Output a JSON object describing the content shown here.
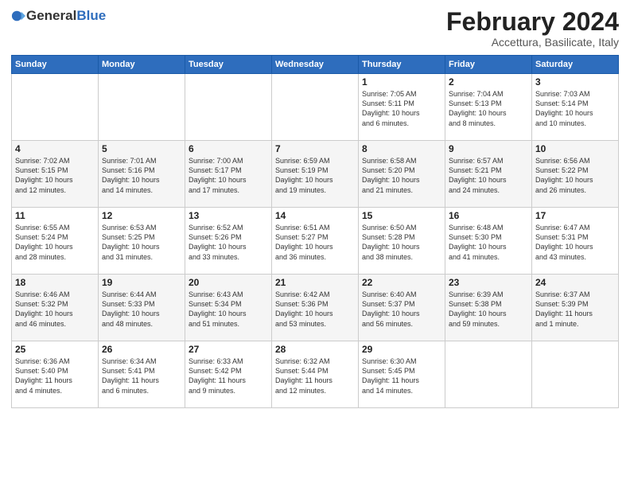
{
  "header": {
    "logo_general": "General",
    "logo_blue": "Blue",
    "month": "February 2024",
    "location": "Accettura, Basilicate, Italy"
  },
  "days_of_week": [
    "Sunday",
    "Monday",
    "Tuesday",
    "Wednesday",
    "Thursday",
    "Friday",
    "Saturday"
  ],
  "weeks": [
    [
      {
        "day": "",
        "content": ""
      },
      {
        "day": "",
        "content": ""
      },
      {
        "day": "",
        "content": ""
      },
      {
        "day": "",
        "content": ""
      },
      {
        "day": "1",
        "content": "Sunrise: 7:05 AM\nSunset: 5:11 PM\nDaylight: 10 hours\nand 6 minutes."
      },
      {
        "day": "2",
        "content": "Sunrise: 7:04 AM\nSunset: 5:13 PM\nDaylight: 10 hours\nand 8 minutes."
      },
      {
        "day": "3",
        "content": "Sunrise: 7:03 AM\nSunset: 5:14 PM\nDaylight: 10 hours\nand 10 minutes."
      }
    ],
    [
      {
        "day": "4",
        "content": "Sunrise: 7:02 AM\nSunset: 5:15 PM\nDaylight: 10 hours\nand 12 minutes."
      },
      {
        "day": "5",
        "content": "Sunrise: 7:01 AM\nSunset: 5:16 PM\nDaylight: 10 hours\nand 14 minutes."
      },
      {
        "day": "6",
        "content": "Sunrise: 7:00 AM\nSunset: 5:17 PM\nDaylight: 10 hours\nand 17 minutes."
      },
      {
        "day": "7",
        "content": "Sunrise: 6:59 AM\nSunset: 5:19 PM\nDaylight: 10 hours\nand 19 minutes."
      },
      {
        "day": "8",
        "content": "Sunrise: 6:58 AM\nSunset: 5:20 PM\nDaylight: 10 hours\nand 21 minutes."
      },
      {
        "day": "9",
        "content": "Sunrise: 6:57 AM\nSunset: 5:21 PM\nDaylight: 10 hours\nand 24 minutes."
      },
      {
        "day": "10",
        "content": "Sunrise: 6:56 AM\nSunset: 5:22 PM\nDaylight: 10 hours\nand 26 minutes."
      }
    ],
    [
      {
        "day": "11",
        "content": "Sunrise: 6:55 AM\nSunset: 5:24 PM\nDaylight: 10 hours\nand 28 minutes."
      },
      {
        "day": "12",
        "content": "Sunrise: 6:53 AM\nSunset: 5:25 PM\nDaylight: 10 hours\nand 31 minutes."
      },
      {
        "day": "13",
        "content": "Sunrise: 6:52 AM\nSunset: 5:26 PM\nDaylight: 10 hours\nand 33 minutes."
      },
      {
        "day": "14",
        "content": "Sunrise: 6:51 AM\nSunset: 5:27 PM\nDaylight: 10 hours\nand 36 minutes."
      },
      {
        "day": "15",
        "content": "Sunrise: 6:50 AM\nSunset: 5:28 PM\nDaylight: 10 hours\nand 38 minutes."
      },
      {
        "day": "16",
        "content": "Sunrise: 6:48 AM\nSunset: 5:30 PM\nDaylight: 10 hours\nand 41 minutes."
      },
      {
        "day": "17",
        "content": "Sunrise: 6:47 AM\nSunset: 5:31 PM\nDaylight: 10 hours\nand 43 minutes."
      }
    ],
    [
      {
        "day": "18",
        "content": "Sunrise: 6:46 AM\nSunset: 5:32 PM\nDaylight: 10 hours\nand 46 minutes."
      },
      {
        "day": "19",
        "content": "Sunrise: 6:44 AM\nSunset: 5:33 PM\nDaylight: 10 hours\nand 48 minutes."
      },
      {
        "day": "20",
        "content": "Sunrise: 6:43 AM\nSunset: 5:34 PM\nDaylight: 10 hours\nand 51 minutes."
      },
      {
        "day": "21",
        "content": "Sunrise: 6:42 AM\nSunset: 5:36 PM\nDaylight: 10 hours\nand 53 minutes."
      },
      {
        "day": "22",
        "content": "Sunrise: 6:40 AM\nSunset: 5:37 PM\nDaylight: 10 hours\nand 56 minutes."
      },
      {
        "day": "23",
        "content": "Sunrise: 6:39 AM\nSunset: 5:38 PM\nDaylight: 10 hours\nand 59 minutes."
      },
      {
        "day": "24",
        "content": "Sunrise: 6:37 AM\nSunset: 5:39 PM\nDaylight: 11 hours\nand 1 minute."
      }
    ],
    [
      {
        "day": "25",
        "content": "Sunrise: 6:36 AM\nSunset: 5:40 PM\nDaylight: 11 hours\nand 4 minutes."
      },
      {
        "day": "26",
        "content": "Sunrise: 6:34 AM\nSunset: 5:41 PM\nDaylight: 11 hours\nand 6 minutes."
      },
      {
        "day": "27",
        "content": "Sunrise: 6:33 AM\nSunset: 5:42 PM\nDaylight: 11 hours\nand 9 minutes."
      },
      {
        "day": "28",
        "content": "Sunrise: 6:32 AM\nSunset: 5:44 PM\nDaylight: 11 hours\nand 12 minutes."
      },
      {
        "day": "29",
        "content": "Sunrise: 6:30 AM\nSunset: 5:45 PM\nDaylight: 11 hours\nand 14 minutes."
      },
      {
        "day": "",
        "content": ""
      },
      {
        "day": "",
        "content": ""
      }
    ]
  ]
}
